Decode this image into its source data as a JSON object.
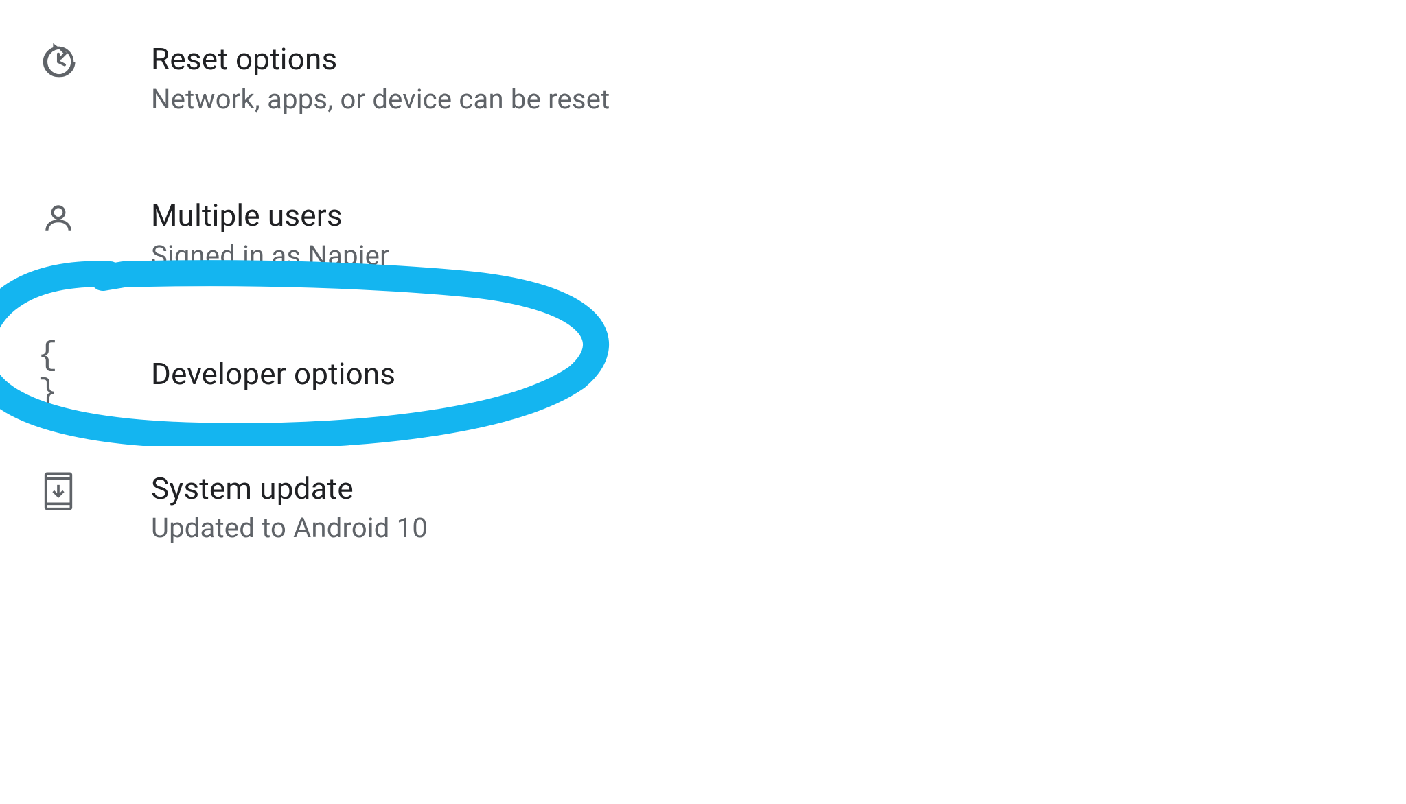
{
  "settings": {
    "items": [
      {
        "title": "Reset options",
        "subtitle": "Network, apps, or device can be reset"
      },
      {
        "title": "Multiple users",
        "subtitle": "Signed in as Napier"
      },
      {
        "title": "Developer options",
        "subtitle": ""
      },
      {
        "title": "System update",
        "subtitle": "Updated to Android 10"
      }
    ]
  },
  "annotation": {
    "color": "#14b5f0",
    "highlighted_item": "Developer options"
  }
}
